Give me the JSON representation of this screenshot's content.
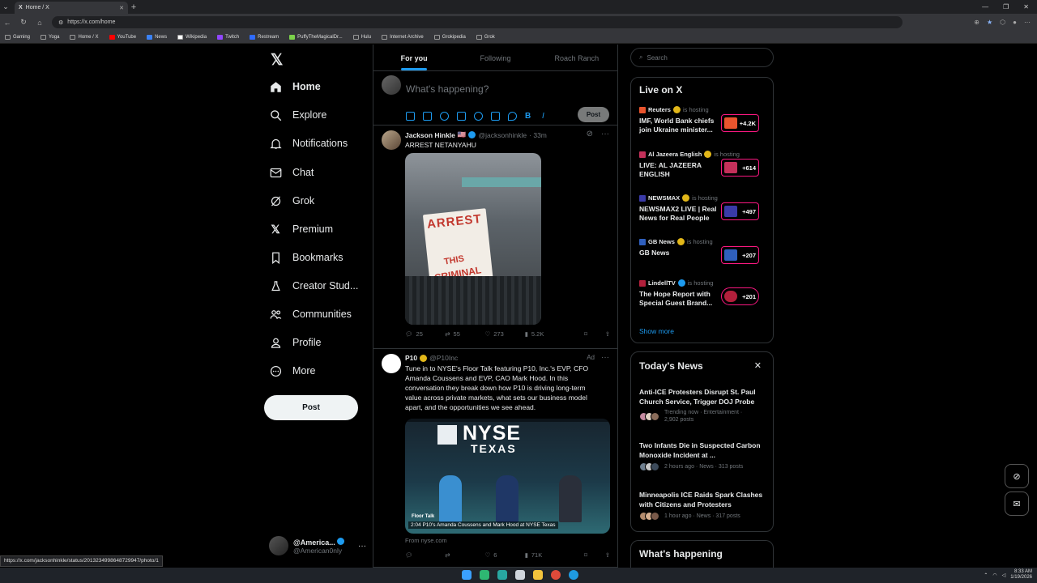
{
  "browser": {
    "tab_title": "Home / X",
    "url": "https://x.com/home",
    "bookmarks": [
      "Gaming",
      "Yoga",
      "Home / X",
      "YouTube",
      "News",
      "Wikipedia",
      "Twitch",
      "Restream",
      "PuffyTheMagicalDr...",
      "Hulu",
      "Internet Archive",
      "Grokipedia",
      "Grok"
    ],
    "status_url": "https://x.com/jacksonhinkle/status/2013234998648729947/photo/1"
  },
  "nav": {
    "items": [
      {
        "label": "Home",
        "icon": "home-icon"
      },
      {
        "label": "Explore",
        "icon": "search-icon"
      },
      {
        "label": "Notifications",
        "icon": "bell-icon"
      },
      {
        "label": "Chat",
        "icon": "mail-icon"
      },
      {
        "label": "Grok",
        "icon": "grok-icon"
      },
      {
        "label": "Premium",
        "icon": "x-icon"
      },
      {
        "label": "Bookmarks",
        "icon": "bookmark-icon"
      },
      {
        "label": "Creator Stud...",
        "icon": "creator-icon"
      },
      {
        "label": "Communities",
        "icon": "people-icon"
      },
      {
        "label": "Profile",
        "icon": "person-icon"
      },
      {
        "label": "More",
        "icon": "more-icon"
      }
    ],
    "post_label": "Post",
    "account": {
      "name": "@America...",
      "handle": "@American0nly"
    }
  },
  "feed": {
    "tabs": [
      "For you",
      "Following",
      "Roach Ranch"
    ],
    "composer_placeholder": "What's happening?",
    "composer_post": "Post",
    "tweets": [
      {
        "name": "Jackson Hinkle",
        "flag": "🇺🇸",
        "handle": "@jacksonhinkle",
        "time": "· 33m",
        "text": "ARREST NETANYAHU",
        "sign_line1": "ARREST",
        "sign_line2": "THIS",
        "sign_line3": "CRIMINAL",
        "replies": "25",
        "reposts": "55",
        "likes": "273",
        "views": "5.2K"
      },
      {
        "name": "P10",
        "handle": "@P10Inc",
        "ad": "Ad",
        "text": "Tune in to NYSE's Floor Talk featuring P10, Inc.'s EVP, CFO Amanda Coussens and EVP, CAO Mark Hood. In this conversation they break down how P10 is driving long-term value across private markets, what sets our business model apart, and the opportunities we see ahead.",
        "media_top": "NYSE",
        "media_sub": "TEXAS",
        "media_label": "Floor Talk",
        "media_caption": "2:04  P10's Amanda Coussens and Mark Hood at NYSE Texas",
        "source": "From nyse.com",
        "likes": "6",
        "views": "71K"
      }
    ]
  },
  "sidebar": {
    "search_placeholder": "Search",
    "live_title": "Live on X",
    "live": [
      {
        "host": "Reuters",
        "hosting": "is hosting",
        "title": "IMF, World Bank chiefs join Ukraine minister...",
        "count": "+4.2K",
        "color": "#e8542d"
      },
      {
        "host": "Al Jazeera English",
        "hosting": "is hosting",
        "title": "LIVE: AL JAZEERA ENGLISH",
        "count": "+614",
        "color": "#c3305a"
      },
      {
        "host": "NEWSMAX",
        "hosting": "is hosting",
        "title": "NEWSMAX2 LIVE | Real News for Real People",
        "count": "+497",
        "color": "#3a3aa8"
      },
      {
        "host": "GB News",
        "hosting": "is hosting",
        "title": "GB News",
        "count": "+207",
        "color": "#2f5fbd"
      },
      {
        "host": "LindellTV",
        "hosting": "is hosting",
        "title": "The Hope Report with Special Guest  Brand...",
        "count": "+201",
        "color": "#b21f3b"
      }
    ],
    "show_more": "Show more",
    "news_title": "Today's News",
    "news": [
      {
        "title": "Anti-ICE Protesters Disrupt St. Paul Church Service, Trigger DOJ Probe",
        "meta": "Trending now · Entertainment · 2,902 posts"
      },
      {
        "title": "Two Infants Die in Suspected Carbon Monoxide Incident at ...",
        "meta": "2 hours ago · News · 313 posts"
      },
      {
        "title": "Minneapolis ICE Raids Spark Clashes with Citizens and Protesters",
        "meta": "1 hour ago · News · 317 posts"
      }
    ],
    "happening_title": "What's happening"
  },
  "taskbar": {
    "time": "8:33 AM",
    "date": "1/19/2026"
  }
}
